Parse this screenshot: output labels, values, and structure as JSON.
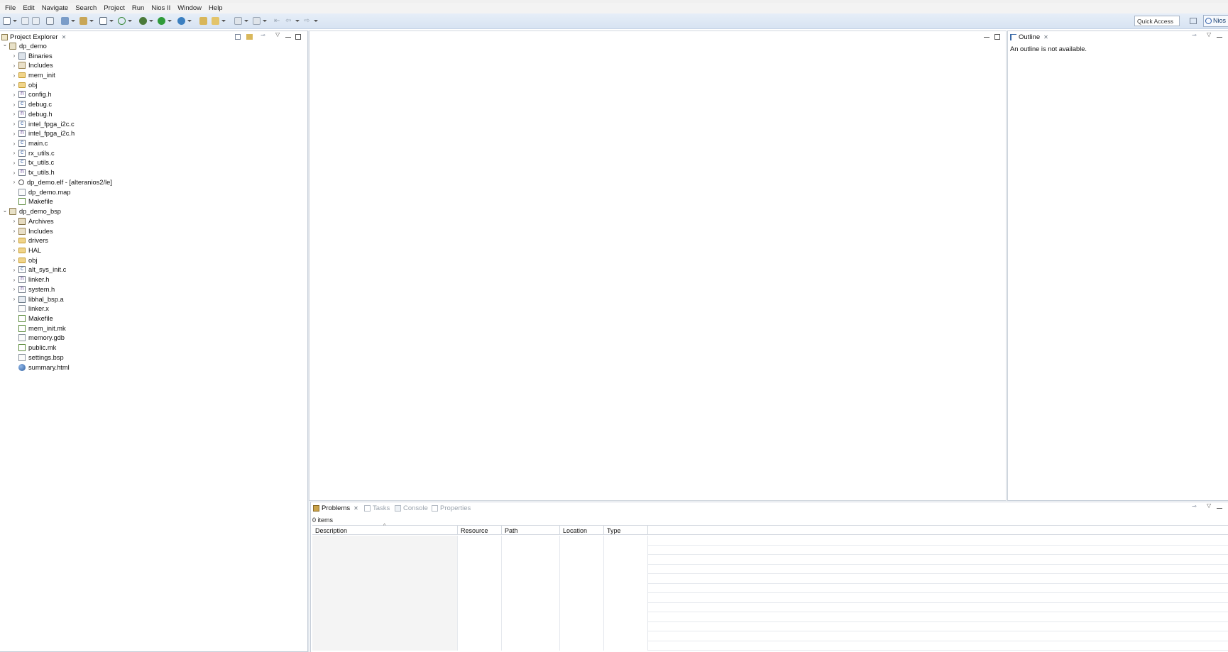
{
  "menu": [
    "File",
    "Edit",
    "Navigate",
    "Search",
    "Project",
    "Run",
    "Nios II",
    "Window",
    "Help"
  ],
  "toolbar": {
    "quick_access": "Quick Access",
    "perspective": "Nios"
  },
  "explorer": {
    "tab_label": "Project Explorer",
    "tree": [
      {
        "label": "dp_demo",
        "depth": 0,
        "icon": "project-icon",
        "expanded": true
      },
      {
        "label": "Binaries",
        "depth": 1,
        "icon": "binaries-icon"
      },
      {
        "label": "Includes",
        "depth": 1,
        "icon": "includes-icon"
      },
      {
        "label": "mem_init",
        "depth": 1,
        "icon": "folder-icon"
      },
      {
        "label": "obj",
        "depth": 1,
        "icon": "folder-icon"
      },
      {
        "label": "config.h",
        "depth": 1,
        "icon": "header-file-icon"
      },
      {
        "label": "debug.c",
        "depth": 1,
        "icon": "c-file-icon"
      },
      {
        "label": "debug.h",
        "depth": 1,
        "icon": "header-file-icon"
      },
      {
        "label": "intel_fpga_i2c.c",
        "depth": 1,
        "icon": "c-file-icon"
      },
      {
        "label": "intel_fpga_i2c.h",
        "depth": 1,
        "icon": "header-file-icon"
      },
      {
        "label": "main.c",
        "depth": 1,
        "icon": "c-file-icon"
      },
      {
        "label": "rx_utils.c",
        "depth": 1,
        "icon": "c-file-icon"
      },
      {
        "label": "tx_utils.c",
        "depth": 1,
        "icon": "c-file-icon"
      },
      {
        "label": "tx_utils.h",
        "depth": 1,
        "icon": "header-file-icon"
      },
      {
        "label": "dp_demo.elf - [alteranios2/le]",
        "depth": 1,
        "icon": "elf-icon"
      },
      {
        "label": "dp_demo.map",
        "depth": 1,
        "icon": "file-icon",
        "leaf": true
      },
      {
        "label": "Makefile",
        "depth": 1,
        "icon": "makefile-icon",
        "leaf": true
      },
      {
        "label": "dp_demo_bsp",
        "depth": 0,
        "icon": "project-icon",
        "expanded": true
      },
      {
        "label": "Archives",
        "depth": 1,
        "icon": "archives-icon"
      },
      {
        "label": "Includes",
        "depth": 1,
        "icon": "includes-icon"
      },
      {
        "label": "drivers",
        "depth": 1,
        "icon": "folder-icon"
      },
      {
        "label": "HAL",
        "depth": 1,
        "icon": "folder-icon"
      },
      {
        "label": "obj",
        "depth": 1,
        "icon": "folder-icon"
      },
      {
        "label": "alt_sys_init.c",
        "depth": 1,
        "icon": "c-file-icon"
      },
      {
        "label": "linker.h",
        "depth": 1,
        "icon": "header-file-icon"
      },
      {
        "label": "system.h",
        "depth": 1,
        "icon": "header-file-icon"
      },
      {
        "label": "libhal_bsp.a",
        "depth": 1,
        "icon": "library-icon"
      },
      {
        "label": "linker.x",
        "depth": 1,
        "icon": "file-icon",
        "leaf": true
      },
      {
        "label": "Makefile",
        "depth": 1,
        "icon": "makefile-icon",
        "leaf": true
      },
      {
        "label": "mem_init.mk",
        "depth": 1,
        "icon": "makefile-icon",
        "leaf": true
      },
      {
        "label": "memory.gdb",
        "depth": 1,
        "icon": "file-icon",
        "leaf": true
      },
      {
        "label": "public.mk",
        "depth": 1,
        "icon": "makefile-icon",
        "leaf": true
      },
      {
        "label": "settings.bsp",
        "depth": 1,
        "icon": "file-icon",
        "leaf": true
      },
      {
        "label": "summary.html",
        "depth": 1,
        "icon": "html-icon",
        "leaf": true
      }
    ]
  },
  "outline": {
    "tab_label": "Outline",
    "message": "An outline is not available."
  },
  "bottom": {
    "tabs": [
      "Problems",
      "Tasks",
      "Console",
      "Properties"
    ],
    "items_count": "0 items",
    "columns": [
      "Description",
      "Resource",
      "Path",
      "Location",
      "Type"
    ]
  },
  "colors": {
    "toolbar_bg": "#dbe6f3",
    "accent": "#2a5aa8"
  }
}
